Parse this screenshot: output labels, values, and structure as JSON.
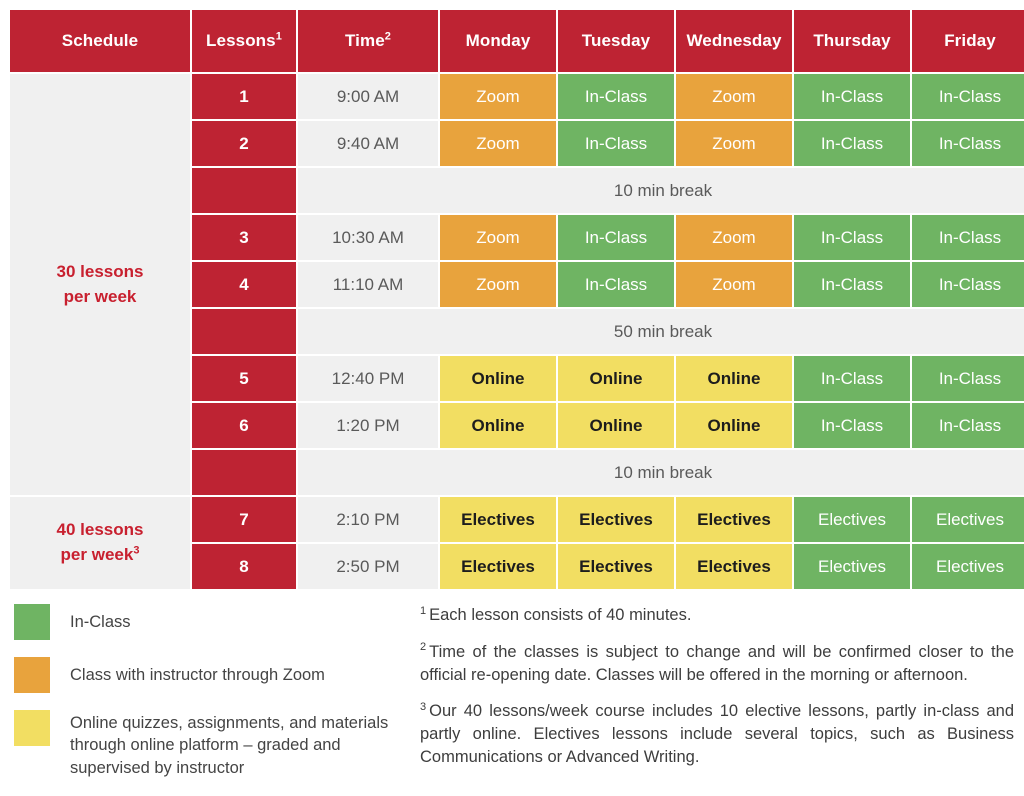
{
  "colors": {
    "red": "#BE2333",
    "green": "#6FB463",
    "orange": "#E8A33D",
    "yellow": "#F2DE62",
    "gray": "#F0F0F0",
    "label_red": "#C8202F"
  },
  "table": {
    "headers": {
      "schedule": "Schedule",
      "lessons": "Lessons",
      "lessons_sup": "1",
      "time": "Time",
      "time_sup": "2",
      "monday": "Monday",
      "tuesday": "Tuesday",
      "wednesday": "Wednesday",
      "thursday": "Thursday",
      "friday": "Friday"
    },
    "group_labels": {
      "group1_line1": "30 lessons",
      "group1_line2": "per week",
      "group2_line1": "40 lessons",
      "group2_line2": "per week",
      "group2_sup": "3"
    },
    "rows": [
      {
        "kind": "lesson",
        "lesson": "1",
        "time": "9:00 AM",
        "cells": [
          {
            "label": "Zoom",
            "type": "orange"
          },
          {
            "label": "In-Class",
            "type": "green"
          },
          {
            "label": "Zoom",
            "type": "orange"
          },
          {
            "label": "In-Class",
            "type": "green"
          },
          {
            "label": "In-Class",
            "type": "green"
          }
        ]
      },
      {
        "kind": "lesson",
        "lesson": "2",
        "time": "9:40 AM",
        "cells": [
          {
            "label": "Zoom",
            "type": "orange"
          },
          {
            "label": "In-Class",
            "type": "green"
          },
          {
            "label": "Zoom",
            "type": "orange"
          },
          {
            "label": "In-Class",
            "type": "green"
          },
          {
            "label": "In-Class",
            "type": "green"
          }
        ]
      },
      {
        "kind": "break",
        "label": "10 min break"
      },
      {
        "kind": "lesson",
        "lesson": "3",
        "time": "10:30 AM",
        "cells": [
          {
            "label": "Zoom",
            "type": "orange"
          },
          {
            "label": "In-Class",
            "type": "green"
          },
          {
            "label": "Zoom",
            "type": "orange"
          },
          {
            "label": "In-Class",
            "type": "green"
          },
          {
            "label": "In-Class",
            "type": "green"
          }
        ]
      },
      {
        "kind": "lesson",
        "lesson": "4",
        "time": "11:10 AM",
        "cells": [
          {
            "label": "Zoom",
            "type": "orange"
          },
          {
            "label": "In-Class",
            "type": "green"
          },
          {
            "label": "Zoom",
            "type": "orange"
          },
          {
            "label": "In-Class",
            "type": "green"
          },
          {
            "label": "In-Class",
            "type": "green"
          }
        ]
      },
      {
        "kind": "break",
        "label": "50 min break"
      },
      {
        "kind": "lesson",
        "lesson": "5",
        "time": "12:40 PM",
        "cells": [
          {
            "label": "Online",
            "type": "yellow"
          },
          {
            "label": "Online",
            "type": "yellow"
          },
          {
            "label": "Online",
            "type": "yellow"
          },
          {
            "label": "In-Class",
            "type": "green"
          },
          {
            "label": "In-Class",
            "type": "green"
          }
        ]
      },
      {
        "kind": "lesson",
        "lesson": "6",
        "time": "1:20 PM",
        "cells": [
          {
            "label": "Online",
            "type": "yellow"
          },
          {
            "label": "Online",
            "type": "yellow"
          },
          {
            "label": "Online",
            "type": "yellow"
          },
          {
            "label": "In-Class",
            "type": "green"
          },
          {
            "label": "In-Class",
            "type": "green"
          }
        ]
      },
      {
        "kind": "break",
        "label": "10 min break"
      },
      {
        "kind": "lesson",
        "lesson": "7",
        "time": "2:10 PM",
        "cells": [
          {
            "label": "Electives",
            "type": "yellow"
          },
          {
            "label": "Electives",
            "type": "yellow"
          },
          {
            "label": "Electives",
            "type": "yellow"
          },
          {
            "label": "Electives",
            "type": "green"
          },
          {
            "label": "Electives",
            "type": "green"
          }
        ]
      },
      {
        "kind": "lesson",
        "lesson": "8",
        "time": "2:50 PM",
        "cells": [
          {
            "label": "Electives",
            "type": "yellow"
          },
          {
            "label": "Electives",
            "type": "yellow"
          },
          {
            "label": "Electives",
            "type": "yellow"
          },
          {
            "label": "Electives",
            "type": "green"
          },
          {
            "label": "Electives",
            "type": "green"
          }
        ]
      }
    ]
  },
  "legend": {
    "items": [
      {
        "swatch": "green",
        "text": "In-Class"
      },
      {
        "swatch": "orange",
        "text": "Class with instructor through Zoom"
      },
      {
        "swatch": "yellow",
        "text": "Online quizzes, assignments, and materials through online platform – graded and supervised by instructor"
      }
    ]
  },
  "footnotes": [
    {
      "marker": "1",
      "text": "Each lesson consists of 40 minutes."
    },
    {
      "marker": "2",
      "text": "Time of the classes is subject to change and will be confirmed closer to the official re-opening date. Classes will be offered in the morning or afternoon."
    },
    {
      "marker": "3",
      "text": "Our 40 lessons/week course includes 10 elective lessons, partly in-class and partly online. Electives lessons include several topics, such as Business Communications or Advanced Writing."
    }
  ]
}
